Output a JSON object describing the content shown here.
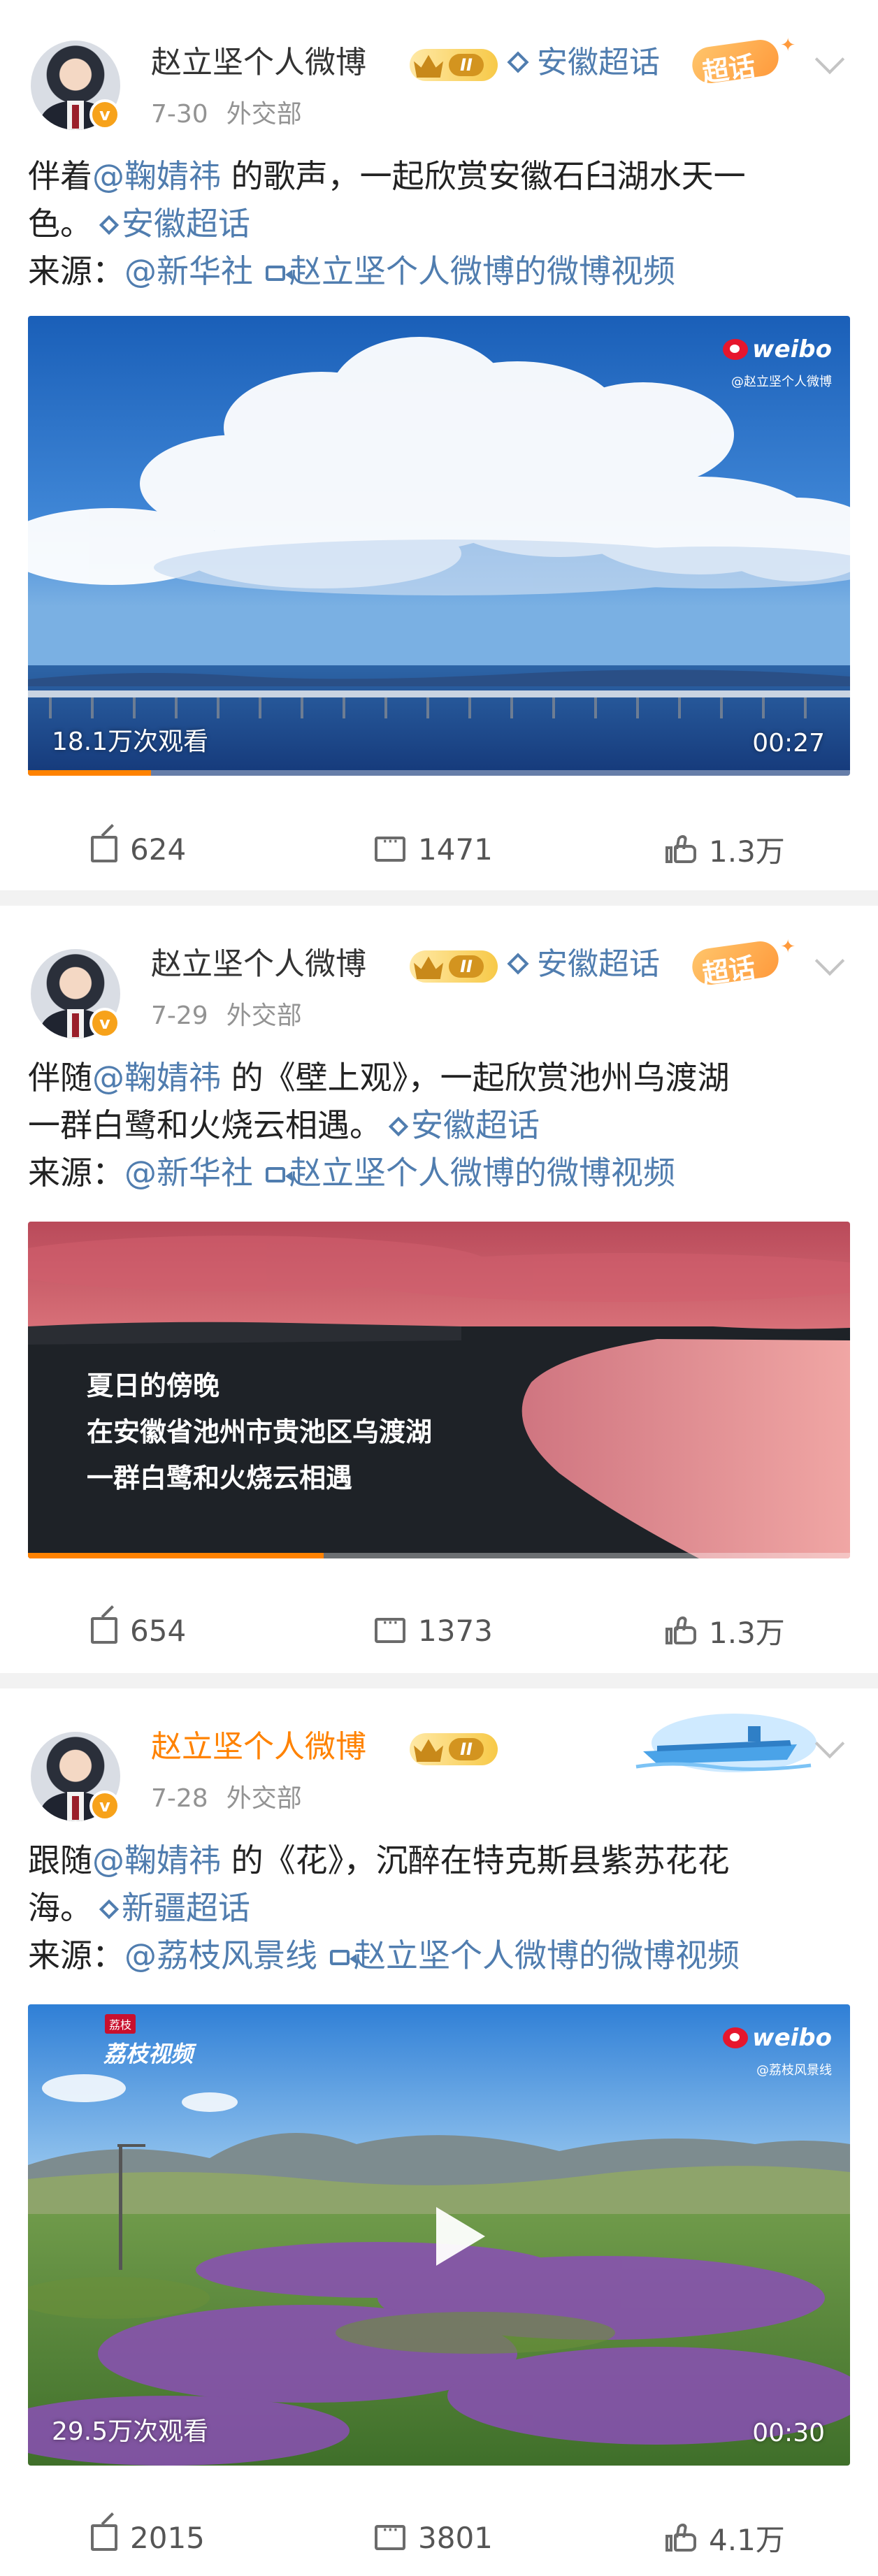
{
  "posts": [
    {
      "author": "赵立坚个人微博",
      "level_badge": "II",
      "verified_badge": "v",
      "topic": "安徽超话",
      "super_tag": "超话",
      "date": "7-30",
      "source_org": "外交部",
      "text_line1_prefix": "伴着",
      "mention": "@鞠婧祎",
      "text_line1_suffix": " 的歌声，一起欣赏安徽石臼湖水天一",
      "text_line2": "色。",
      "inline_topic": "安徽超话",
      "source_label": "来源：",
      "source_mention": "@新华社",
      "video_link": "赵立坚个人微博的微博视频",
      "watermark": "weibo",
      "watermark_sub": "@赵立坚个人微博",
      "views": "18.1万次观看",
      "duration": "00:27",
      "progress_fraction": 0.15,
      "shares": "624",
      "comments": "1471",
      "likes": "1.3万"
    },
    {
      "author": "赵立坚个人微博",
      "level_badge": "II",
      "verified_badge": "v",
      "topic": "安徽超话",
      "super_tag": "超话",
      "date": "7-29",
      "source_org": "外交部",
      "text_line1_prefix": "伴随",
      "mention": "@鞠婧祎",
      "text_line1_suffix": " 的《壁上观》，一起欣赏池州乌渡湖",
      "text_line2": "一群白鹭和火烧云相遇。",
      "inline_topic": "安徽超话",
      "source_label": "来源：",
      "source_mention": "@新华社",
      "video_link": "赵立坚个人微博的微博视频",
      "captions": [
        "夏日的傍晚",
        "在安徽省池州市贵池区乌渡湖",
        "一群白鹭和火烧云相遇"
      ],
      "progress_fraction": 0.36,
      "shares": "654",
      "comments": "1373",
      "likes": "1.3万"
    },
    {
      "author": "赵立坚个人微博",
      "level_badge": "II",
      "verified_badge": "v",
      "date": "7-28",
      "source_org": "外交部",
      "text_line1_prefix": "跟随",
      "mention": "@鞠婧祎",
      "text_line1_suffix": " 的《花》，沉醉在特克斯县紫苏花花",
      "text_line2": "海。",
      "inline_topic": "新疆超话",
      "source_label": "来源：",
      "source_mention": "@荔枝风景线",
      "video_link": "赵立坚个人微博的微博视频",
      "brand_watermark": "荔枝视频",
      "brand_tag": "荔枝",
      "watermark": "weibo",
      "watermark_sub": "@荔枝风景线",
      "views": "29.5万次观看",
      "duration": "00:30",
      "shares": "2015",
      "comments": "3801",
      "likes": "4.1万"
    }
  ],
  "colors": {
    "link": "#507daf",
    "vip_name": "#ff8200",
    "verified": "#f7a21a",
    "progress": "#ff8200",
    "background": "#f2f2f2"
  },
  "icons": [
    "share-icon",
    "comment-icon",
    "like-icon",
    "more-chevron-icon",
    "diamond-topic-icon",
    "video-link-icon",
    "play-icon"
  ]
}
